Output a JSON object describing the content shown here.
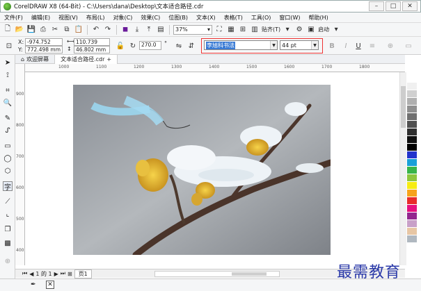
{
  "window": {
    "title": "CorelDRAW X8 (64-Bit) - C:\\Users\\dana\\Desktop\\文本适合路径.cdr",
    "buttons": [
      "–",
      "□",
      "✕"
    ]
  },
  "menu": [
    "文件(F)",
    "编辑(E)",
    "视图(V)",
    "布局(L)",
    "对象(C)",
    "效果(C)",
    "位图(B)",
    "文本(X)",
    "表格(T)",
    "工具(O)",
    "窗口(W)",
    "帮助(H)"
  ],
  "toolbar": {
    "zoom": "37%",
    "snap_label": "贴齐(T)",
    "launch_label": "启动"
  },
  "property_bar": {
    "x_label": "X:",
    "x_value": "-974.752 mm",
    "y_label": "Y:",
    "y_value": "772.498 mm",
    "width_value": "110.739 mm",
    "height_value": "46.802 mm",
    "rotation": "270.0",
    "font_name": "李旭科书法",
    "font_size": "44 pt"
  },
  "tabs": {
    "welcome": "欢迎屏幕",
    "document": "文本适合路径.cdr"
  },
  "ruler": {
    "h_labels": [
      "1000",
      "1100",
      "1200",
      "1300",
      "1400",
      "1500",
      "1600",
      "1700",
      "1800"
    ],
    "v_labels": [
      "900",
      "800",
      "700",
      "600",
      "500",
      "400"
    ]
  },
  "pagebar": {
    "page_of": "1 的 1",
    "page_tab": "页1"
  },
  "palette_colors": [
    "#ffffff",
    "#f0f0f0",
    "#d0d0d0",
    "#b0b0b0",
    "#909090",
    "#707070",
    "#505050",
    "#303030",
    "#101010",
    "#000000",
    "#2233cc",
    "#19a0d8",
    "#39b54a",
    "#8dc63f",
    "#f7ec13",
    "#f6a31b",
    "#e82c2a",
    "#e5127e",
    "#93278f",
    "#c8a0c8",
    "#e7c6a4",
    "#b0b8c0",
    "#ffffff"
  ],
  "watermark": "最需教育"
}
